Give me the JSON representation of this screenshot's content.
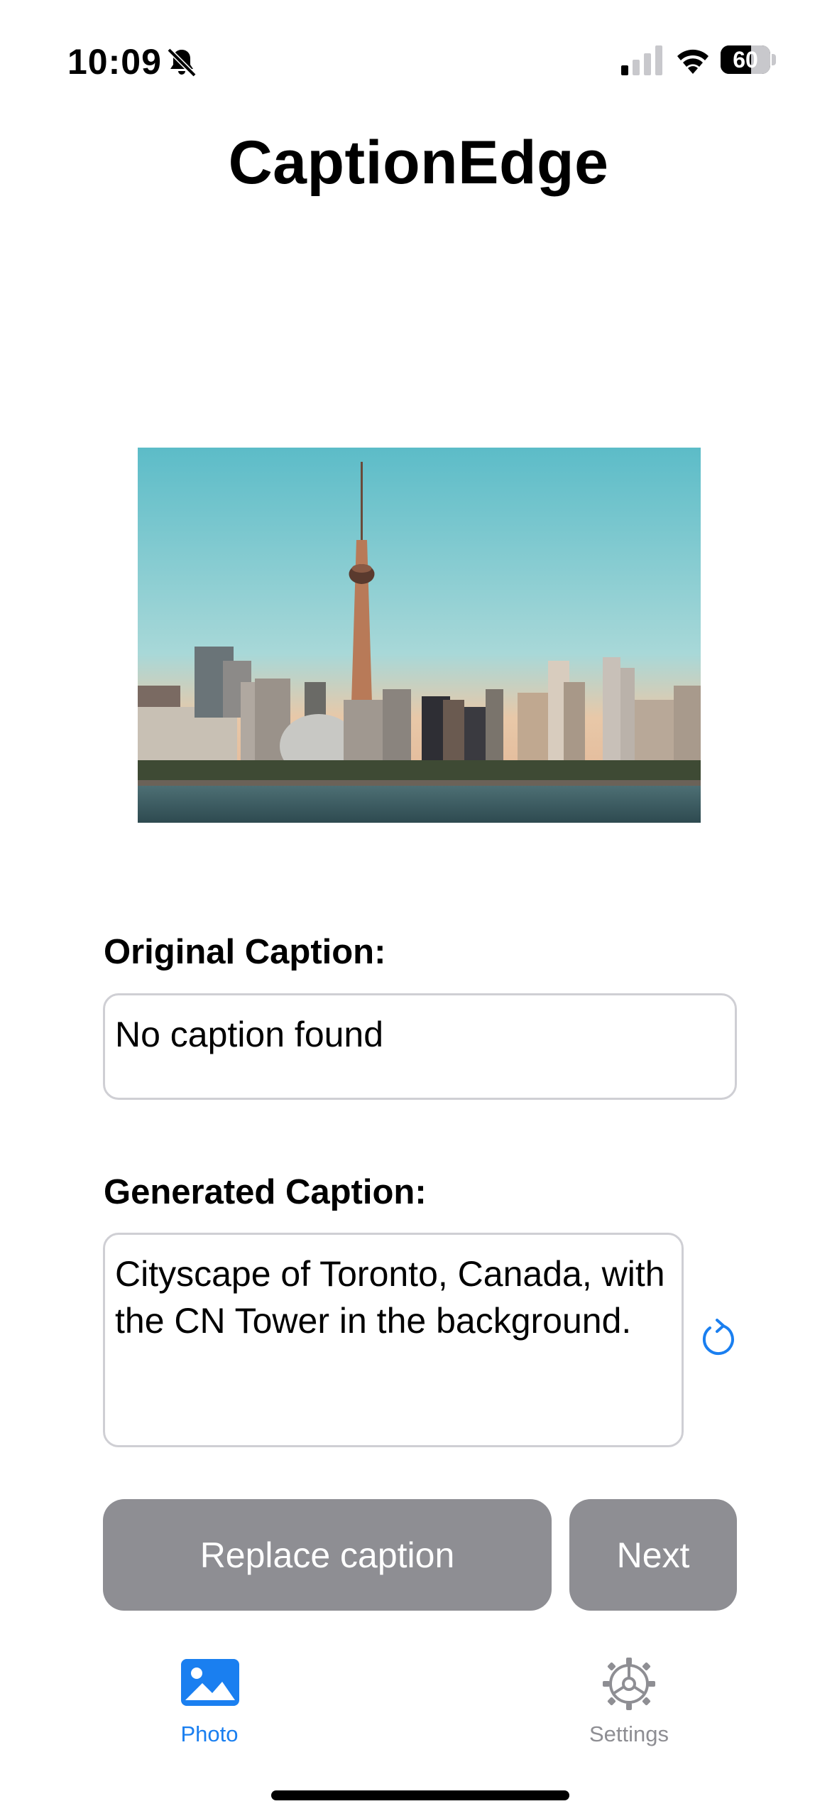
{
  "status_bar": {
    "time": "10:09",
    "battery": "60",
    "icons": [
      "bell-slash-icon",
      "cellular-signal-icon",
      "wifi-icon",
      "battery-icon"
    ]
  },
  "app": {
    "title": "CaptionEdge"
  },
  "photo": {
    "description_icon": "photo-of-toronto-skyline-with-cn-tower"
  },
  "original_caption": {
    "label": "Original Caption:",
    "value": "No caption found"
  },
  "generated_caption": {
    "label": "Generated Caption:",
    "value": "Cityscape of Toronto, Canada, with the CN Tower in the background.",
    "regenerate_icon": "refresh-icon"
  },
  "actions": {
    "replace_label": "Replace caption",
    "next_label": "Next"
  },
  "tab_bar": {
    "tabs": [
      {
        "label": "Photo",
        "icon": "photo-icon",
        "active": true
      },
      {
        "label": "Settings",
        "icon": "gear-icon",
        "active": false
      }
    ]
  },
  "colors": {
    "accent": "#1a7ff0",
    "button_disabled": "#8e8e93",
    "inactive_tab": "#8e8e93",
    "field_border": "#cfcfd4"
  }
}
